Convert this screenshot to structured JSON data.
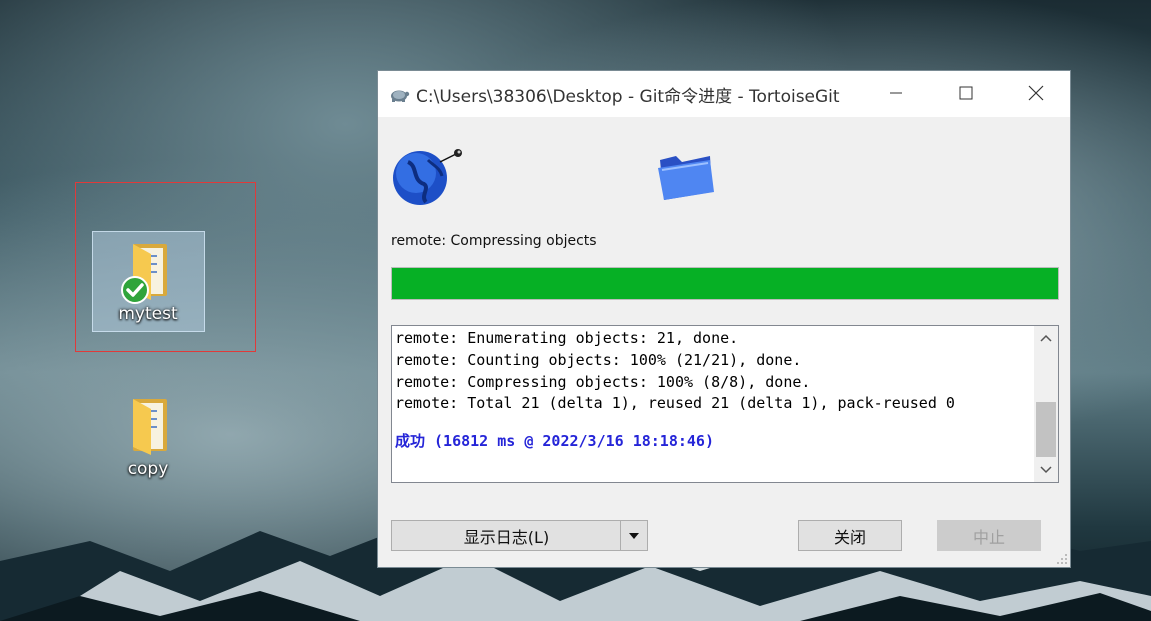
{
  "desktop": {
    "icons": [
      {
        "label": "mytest",
        "status": "synced"
      },
      {
        "label": "copy"
      }
    ]
  },
  "window": {
    "title": "C:\\Users\\38306\\Desktop - Git命令进度 - TortoiseGit",
    "status_text": "remote: Compressing objects",
    "progress_percent": 100,
    "log_lines": [
      "remote: Enumerating objects: 21, done.",
      "remote: Counting objects: 100% (21/21), done.",
      "remote: Compressing objects: 100% (8/8), done.",
      "remote: Total 21 (delta 1), reused 21 (delta 1), pack-reused 0"
    ],
    "success_line": "成功 (16812 ms @ 2022/3/16 18:18:46)",
    "buttons": {
      "show_log": "显示日志(L)",
      "close": "关闭",
      "abort": "中止"
    }
  },
  "colors": {
    "progress_fill": "#06b025",
    "success_text": "#2525d8",
    "selection_border": "#e03a3a"
  }
}
